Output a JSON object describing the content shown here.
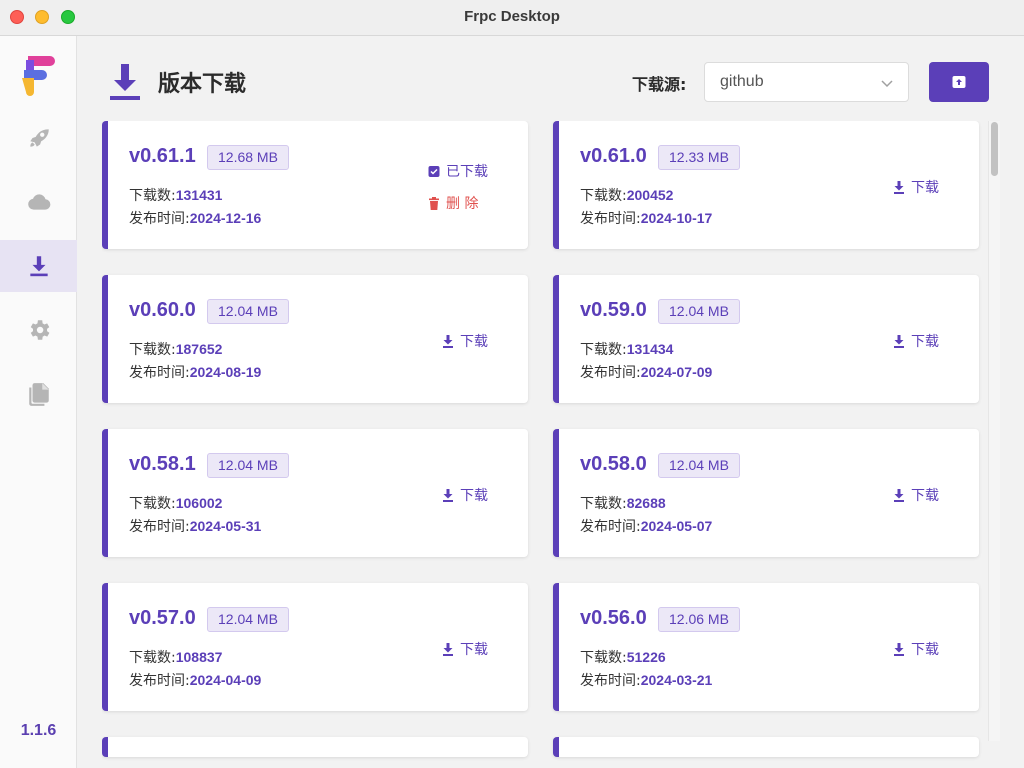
{
  "window": {
    "title": "Frpc Desktop"
  },
  "sidebar": {
    "items": [
      {
        "name": "rocket",
        "icon": "rocket-icon",
        "active": false
      },
      {
        "name": "cloud",
        "icon": "cloud-icon",
        "active": false
      },
      {
        "name": "download",
        "icon": "download-icon",
        "active": true
      },
      {
        "name": "settings",
        "icon": "gear-icon",
        "active": false
      },
      {
        "name": "logs",
        "icon": "files-icon",
        "active": false
      }
    ],
    "app_version": "1.1.6"
  },
  "header": {
    "title": "版本下载",
    "source_label": "下载源:",
    "source_value": "github",
    "import_button_icon": "archive-upload-icon"
  },
  "labels": {
    "downloads": "下载数:",
    "published": "发布时间:",
    "download": "下载",
    "downloaded": "已下载",
    "delete": "删 除"
  },
  "versions": [
    {
      "version": "v0.61.1",
      "size": "12.68 MB",
      "downloads": "131431",
      "date": "2024-12-16",
      "downloaded": true
    },
    {
      "version": "v0.61.0",
      "size": "12.33 MB",
      "downloads": "200452",
      "date": "2024-10-17",
      "downloaded": false
    },
    {
      "version": "v0.60.0",
      "size": "12.04 MB",
      "downloads": "187652",
      "date": "2024-08-19",
      "downloaded": false
    },
    {
      "version": "v0.59.0",
      "size": "12.04 MB",
      "downloads": "131434",
      "date": "2024-07-09",
      "downloaded": false
    },
    {
      "version": "v0.58.1",
      "size": "12.04 MB",
      "downloads": "106002",
      "date": "2024-05-31",
      "downloaded": false
    },
    {
      "version": "v0.58.0",
      "size": "12.04 MB",
      "downloads": "82688",
      "date": "2024-05-07",
      "downloaded": false
    },
    {
      "version": "v0.57.0",
      "size": "12.04 MB",
      "downloads": "108837",
      "date": "2024-04-09",
      "downloaded": false
    },
    {
      "version": "v0.56.0",
      "size": "12.06 MB",
      "downloads": "51226",
      "date": "2024-03-21",
      "downloaded": false
    }
  ],
  "colors": {
    "accent": "#5b3fb8",
    "danger": "#e0504d",
    "badge_bg": "#ece8f7"
  }
}
